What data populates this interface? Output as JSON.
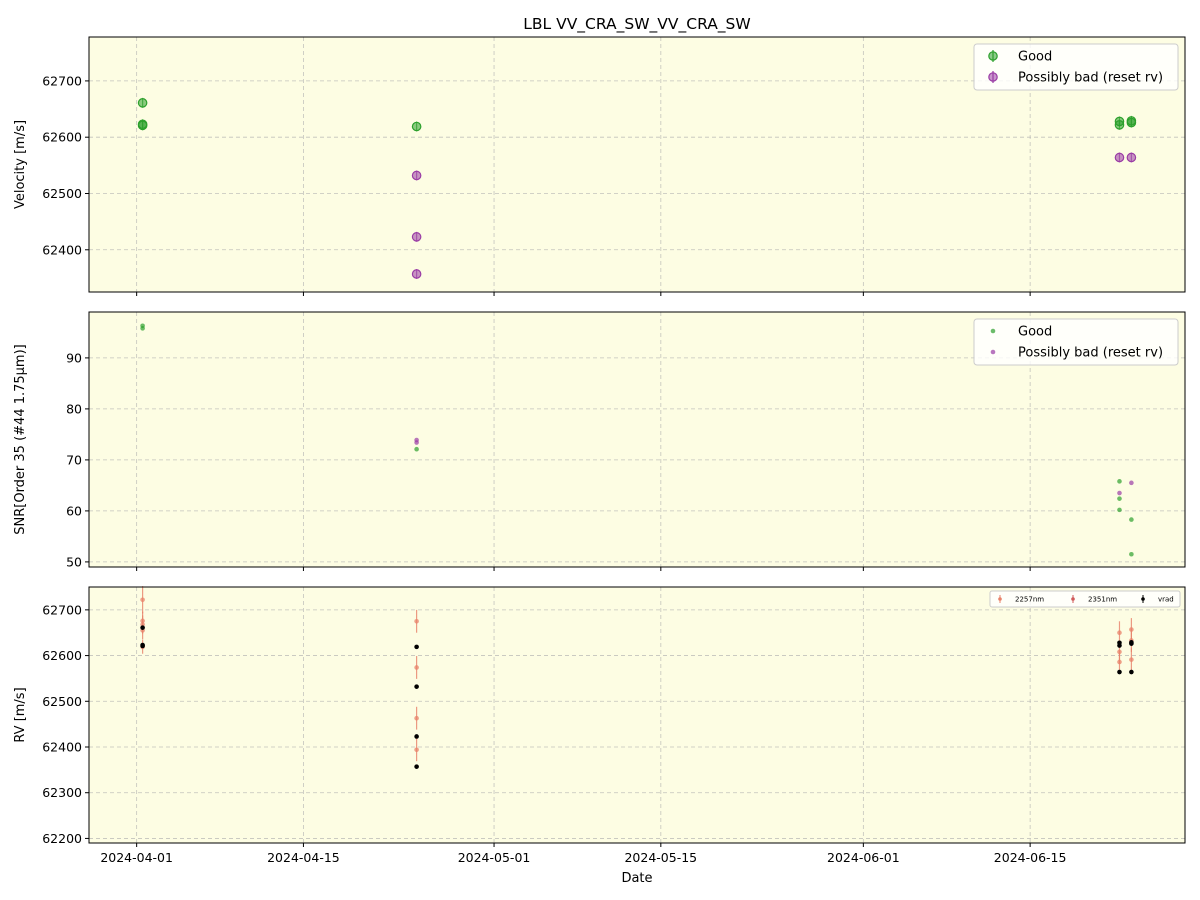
{
  "chart_data": {
    "title": "LBL VV_CRA_SW_VV_CRA_SW",
    "xlabel": "Date",
    "x_ticks": [
      "2024-04-01",
      "2024-04-15",
      "2024-05-01",
      "2024-05-15",
      "2024-06-01",
      "2024-06-15"
    ],
    "xlim": [
      "2024-03-28",
      "2024-06-28"
    ],
    "grid": true,
    "colors": {
      "background": "#fdfde3",
      "good": "#2ca02c",
      "bad": "#9a3ca5",
      "band_2257": "#e8826a",
      "band_2351": "#d05a5a",
      "vrad": "#000000"
    },
    "panels": [
      {
        "type": "scatter",
        "ylabel": "Velocity [m/s]",
        "ylim": [
          62325,
          62778
        ],
        "y_ticks": [
          62400,
          62500,
          62600,
          62700
        ],
        "legend_position": "top-right",
        "series": [
          {
            "name": "Good",
            "color": "#2ca02c",
            "points": [
              {
                "x": "2024-04-01",
                "y": 62661
              },
              {
                "x": "2024-04-01",
                "y": 62623
              },
              {
                "x": "2024-04-01",
                "y": 62621
              },
              {
                "x": "2024-04-24",
                "y": 62619
              },
              {
                "x": "2024-06-22",
                "y": 62628
              },
              {
                "x": "2024-06-22",
                "y": 62622
              },
              {
                "x": "2024-06-23",
                "y": 62629
              },
              {
                "x": "2024-06-23",
                "y": 62626
              }
            ]
          },
          {
            "name": "Possibly bad (reset rv)",
            "color": "#9a3ca5",
            "points": [
              {
                "x": "2024-04-24",
                "y": 62532
              },
              {
                "x": "2024-04-24",
                "y": 62423
              },
              {
                "x": "2024-04-24",
                "y": 62357
              },
              {
                "x": "2024-06-22",
                "y": 62564
              },
              {
                "x": "2024-06-23",
                "y": 62564
              }
            ]
          }
        ]
      },
      {
        "type": "scatter",
        "ylabel": "SNR[Order 35 (#44 1.75μm)]",
        "ylim": [
          49,
          99
        ],
        "y_ticks": [
          50,
          60,
          70,
          80,
          90
        ],
        "legend_position": "top-right",
        "series": [
          {
            "name": "Good",
            "color": "#2ca02c",
            "points": [
              {
                "x": "2024-04-01",
                "y": 96.3
              },
              {
                "x": "2024-04-01",
                "y": 95.8
              },
              {
                "x": "2024-04-24",
                "y": 72.1
              },
              {
                "x": "2024-06-22",
                "y": 65.8
              },
              {
                "x": "2024-06-22",
                "y": 62.4
              },
              {
                "x": "2024-06-22",
                "y": 60.2
              },
              {
                "x": "2024-06-23",
                "y": 58.3
              },
              {
                "x": "2024-06-23",
                "y": 51.5
              }
            ]
          },
          {
            "name": "Possibly bad (reset rv)",
            "color": "#9a3ca5",
            "points": [
              {
                "x": "2024-04-24",
                "y": 73.9
              },
              {
                "x": "2024-04-24",
                "y": 73.4
              },
              {
                "x": "2024-06-22",
                "y": 63.5
              },
              {
                "x": "2024-06-23",
                "y": 65.5
              }
            ]
          }
        ]
      },
      {
        "type": "scatter",
        "ylabel": "RV [m/s]",
        "ylim": [
          62190,
          62750
        ],
        "y_ticks": [
          62200,
          62300,
          62400,
          62500,
          62600,
          62700
        ],
        "legend_position": "top-right",
        "series": [
          {
            "name": "2257nm",
            "color": "#e8826a",
            "points": [
              {
                "x": "2024-04-01",
                "y": 62722,
                "err": 30
              },
              {
                "x": "2024-04-01",
                "y": 62676,
                "err": 20
              },
              {
                "x": "2024-04-01",
                "y": 62668,
                "err": 20
              },
              {
                "x": "2024-04-01",
                "y": 62655,
                "err": 20
              },
              {
                "x": "2024-04-01",
                "y": 62619,
                "err": 15
              },
              {
                "x": "2024-04-24",
                "y": 62675,
                "err": 25
              },
              {
                "x": "2024-04-24",
                "y": 62574,
                "err": 25
              },
              {
                "x": "2024-04-24",
                "y": 62463,
                "err": 25
              },
              {
                "x": "2024-04-24",
                "y": 62394,
                "err": 25
              },
              {
                "x": "2024-06-22",
                "y": 62650,
                "err": 25
              },
              {
                "x": "2024-06-22",
                "y": 62608,
                "err": 25
              },
              {
                "x": "2024-06-22",
                "y": 62586,
                "err": 25
              },
              {
                "x": "2024-06-23",
                "y": 62657,
                "err": 25
              },
              {
                "x": "2024-06-23",
                "y": 62633,
                "err": 25
              },
              {
                "x": "2024-06-23",
                "y": 62591,
                "err": 25
              }
            ]
          },
          {
            "name": "2351nm",
            "color": "#d05a5a",
            "points": []
          },
          {
            "name": "vrad",
            "color": "#000000",
            "points": [
              {
                "x": "2024-04-01",
                "y": 62661,
                "err": 4
              },
              {
                "x": "2024-04-01",
                "y": 62623,
                "err": 4
              },
              {
                "x": "2024-04-01",
                "y": 62621,
                "err": 4
              },
              {
                "x": "2024-04-24",
                "y": 62619,
                "err": 4
              },
              {
                "x": "2024-04-24",
                "y": 62532,
                "err": 4
              },
              {
                "x": "2024-04-24",
                "y": 62423,
                "err": 4
              },
              {
                "x": "2024-04-24",
                "y": 62357,
                "err": 4
              },
              {
                "x": "2024-06-22",
                "y": 62628,
                "err": 4
              },
              {
                "x": "2024-06-22",
                "y": 62622,
                "err": 4
              },
              {
                "x": "2024-06-22",
                "y": 62564,
                "err": 4
              },
              {
                "x": "2024-06-23",
                "y": 62629,
                "err": 4
              },
              {
                "x": "2024-06-23",
                "y": 62626,
                "err": 4
              },
              {
                "x": "2024-06-23",
                "y": 62564,
                "err": 4
              }
            ]
          }
        ]
      }
    ]
  }
}
